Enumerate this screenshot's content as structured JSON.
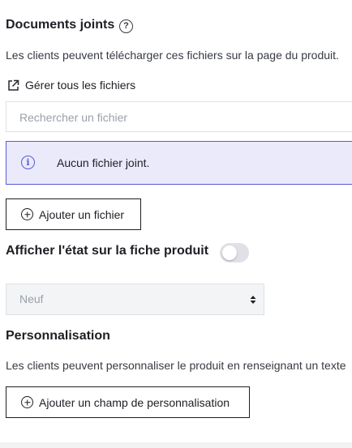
{
  "attachments": {
    "title": "Documents joints",
    "help_icon": "?",
    "description": "Les clients peuvent télécharger ces fichiers sur la page du produit.",
    "manage_link": "Gérer tous les fichiers",
    "search_placeholder": "Rechercher un fichier",
    "empty_alert": "Aucun fichier joint.",
    "add_button": "Ajouter un fichier"
  },
  "condition": {
    "label": "Afficher l'état sur la fiche produit",
    "toggle_on": false,
    "select_value": "Neuf"
  },
  "customization": {
    "title": "Personnalisation",
    "description": "Les clients peuvent personnaliser le produit en renseignant un texte",
    "add_button": "Ajouter un champ de personnalisation"
  },
  "colors": {
    "info_accent": "#5b5bd3",
    "info_background": "#eaeafb"
  },
  "icons": [
    "help-icon",
    "external-link-icon",
    "info-icon",
    "plus-circle-icon",
    "sort-arrows-icon"
  ]
}
